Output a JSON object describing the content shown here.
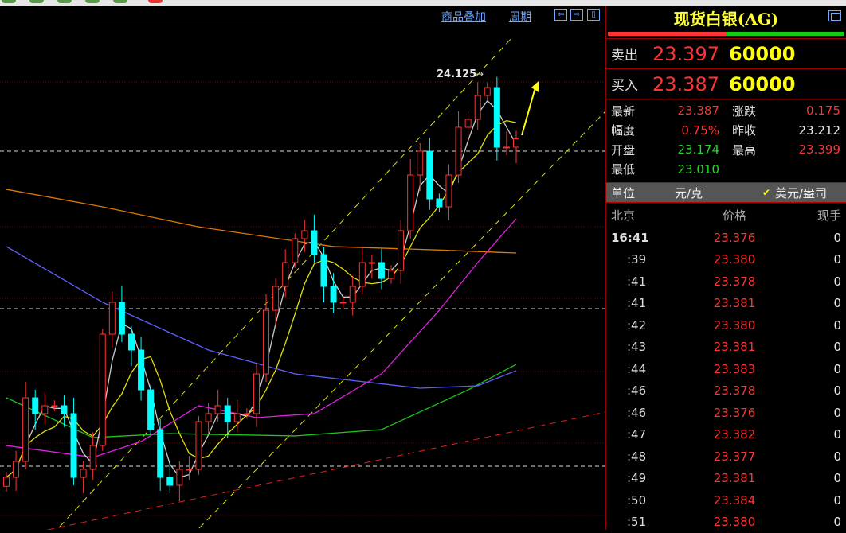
{
  "header": {
    "overlay_label": "商品叠加",
    "period_label": "周期",
    "nav_left": "⇦",
    "nav_right": "⇨",
    "nav_panel": "▯"
  },
  "panel": {
    "title": "现货白银(AG)",
    "ask": {
      "label": "卖出",
      "price": "23.397",
      "volume": "60000"
    },
    "bid": {
      "label": "买入",
      "price": "23.387",
      "volume": "60000"
    },
    "info": [
      {
        "l1": "最新",
        "v1": "23.387",
        "c1": "#ff3333",
        "l2": "涨跌",
        "v2": "0.175",
        "c2": "#ff3333"
      },
      {
        "l1": "幅度",
        "v1": "0.75%",
        "c1": "#ff3333",
        "l2": "昨收",
        "v2": "23.212",
        "c2": "#e8e8e8"
      },
      {
        "l1": "开盘",
        "v1": "23.174",
        "c1": "#22dd22",
        "l2": "最高",
        "v2": "23.399",
        "c2": "#ff3333"
      },
      {
        "l1": "最低",
        "v1": "23.010",
        "c1": "#22dd22",
        "l2": "",
        "v2": "",
        "c2": "#fff"
      }
    ],
    "unit": {
      "label": "单位",
      "opt1": "元/克",
      "check": "✔",
      "opt2": "美元/盎司"
    },
    "ticks_header": {
      "time": "北京",
      "price": "价格",
      "vol": "现手"
    },
    "ticks": [
      {
        "t": "16:41",
        "p": "23.376",
        "v": "0"
      },
      {
        "t": ":39",
        "p": "23.380",
        "v": "0"
      },
      {
        "t": ":41",
        "p": "23.378",
        "v": "0"
      },
      {
        "t": ":41",
        "p": "23.381",
        "v": "0"
      },
      {
        "t": ":42",
        "p": "23.380",
        "v": "0"
      },
      {
        "t": ":43",
        "p": "23.381",
        "v": "0"
      },
      {
        "t": ":44",
        "p": "23.383",
        "v": "0"
      },
      {
        "t": ":46",
        "p": "23.378",
        "v": "0"
      },
      {
        "t": ":46",
        "p": "23.376",
        "v": "0"
      },
      {
        "t": ":47",
        "p": "23.382",
        "v": "0"
      },
      {
        "t": ":48",
        "p": "23.377",
        "v": "0"
      },
      {
        "t": ":49",
        "p": "23.381",
        "v": "0"
      },
      {
        "t": ":50",
        "p": "23.384",
        "v": "0"
      },
      {
        "t": ":51",
        "p": "23.380",
        "v": "0"
      }
    ]
  },
  "colors": {
    "up": "#ff3333",
    "down": "#00ffff",
    "ma5": "#cccccc",
    "ma10": "#e0e000",
    "ma20": "#e020e0",
    "ma60": "#20c020",
    "ma120": "#6060ff",
    "ma250": "#e07800"
  },
  "chart_data": {
    "type": "candlestick",
    "ylim": [
      19.0,
      24.6
    ],
    "high_label": "24.125",
    "closes": [
      19.589,
      19.768,
      20.482,
      20.304,
      20.393,
      20.393,
      20.304,
      19.589,
      19.679,
      19.946,
      21.196,
      21.554,
      21.196,
      21.018,
      20.571,
      20.125,
      19.589,
      19.5,
      19.679,
      19.679,
      20.214,
      20.304,
      20.393,
      20.214,
      20.304,
      20.304,
      20.75,
      21.464,
      21.732,
      22.0,
      22.268,
      22.357,
      22.089,
      21.732,
      21.554,
      21.554,
      21.732,
      22.0,
      22.0,
      21.821,
      21.911,
      22.357,
      22.982,
      23.25,
      22.714,
      22.625,
      22.982,
      23.518,
      23.607,
      23.875,
      23.964,
      23.295,
      23.295,
      23.387
    ],
    "reference_levels": [
      23.25,
      21.482,
      19.714
    ],
    "ma_series": [
      {
        "name": "ma60",
        "idx": [
          0,
          9,
          17,
          30,
          39,
          48,
          53
        ],
        "values": [
          20.482,
          20.036,
          20.08,
          20.054,
          20.125,
          20.571,
          20.857
        ]
      },
      {
        "name": "ma120",
        "idx": [
          0,
          10,
          21,
          30,
          43,
          49,
          53
        ],
        "values": [
          22.179,
          21.554,
          21.018,
          20.75,
          20.589,
          20.616,
          20.786
        ]
      },
      {
        "name": "ma250",
        "idx": [
          0,
          10,
          20,
          34,
          45,
          53
        ],
        "values": [
          22.821,
          22.625,
          22.4,
          22.179,
          22.14,
          22.107
        ]
      },
      {
        "name": "ma20",
        "idx": [
          0,
          9,
          14,
          20,
          26,
          32,
          39,
          45,
          49,
          53
        ],
        "values": [
          19.946,
          19.813,
          19.991,
          20.393,
          20.259,
          20.304,
          20.75,
          21.464,
          22.0,
          22.491
        ]
      }
    ]
  }
}
